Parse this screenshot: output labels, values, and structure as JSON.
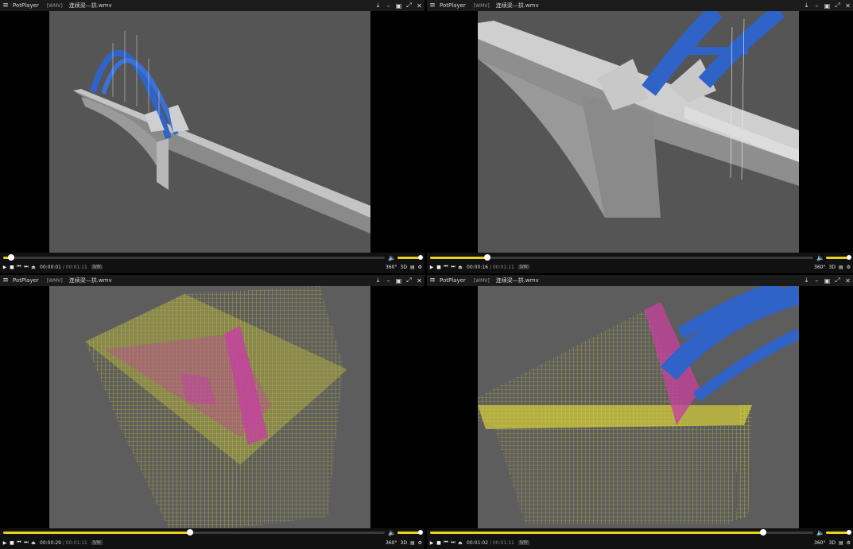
{
  "windows": [
    {
      "app": "PotPlayer",
      "format": "[WMV]",
      "file": "连续梁—拱.wmv",
      "time": "00:00:01",
      "duration": "00:01:11",
      "badge": "S/W",
      "progress": 0.02,
      "volume": 0.95,
      "scene": "overview"
    },
    {
      "app": "PotPlayer",
      "format": "[WMV]",
      "file": "连续梁—拱.wmv",
      "time": "00:00:16",
      "duration": "00:01:11",
      "badge": "S/W",
      "progress": 0.15,
      "volume": 0.95,
      "scene": "pier-closeup"
    },
    {
      "app": "PotPlayer",
      "format": "[WMV]",
      "file": "连续梁—拱.wmv",
      "time": "00:00:29",
      "duration": "00:01:11",
      "badge": "S/W",
      "progress": 0.49,
      "volume": 0.95,
      "scene": "rebar-pink"
    },
    {
      "app": "PotPlayer",
      "format": "[WMV]",
      "file": "连续梁—拱.wmv",
      "time": "00:01:02",
      "duration": "00:01:11",
      "badge": "S/W",
      "progress": 0.87,
      "volume": 0.95,
      "scene": "rebar-blue"
    }
  ],
  "controls": {
    "menu_icon": "hamburger-icon",
    "play_icon": "play-icon",
    "stop_icon": "stop-icon",
    "prev_icon": "prev-icon",
    "next_icon": "next-icon",
    "eject_icon": "eject-icon",
    "label_360": "360°",
    "label_3d": "3D",
    "playlist_icon": "playlist-icon",
    "settings_icon": "gear-icon",
    "volume_icon": "volume-icon",
    "pin_icon": "pin-icon",
    "minimize_icon": "minimize-icon",
    "maximize_icon": "maximize-icon",
    "fullscreen_icon": "fullscreen-icon",
    "close_icon": "close-icon"
  },
  "colors": {
    "accent": "#e8d21c",
    "arch_blue": "#2f63c8",
    "rebar_yellow": "#d8d23a",
    "rebar_pink": "#c2449c",
    "background": "#5d5d5d"
  }
}
